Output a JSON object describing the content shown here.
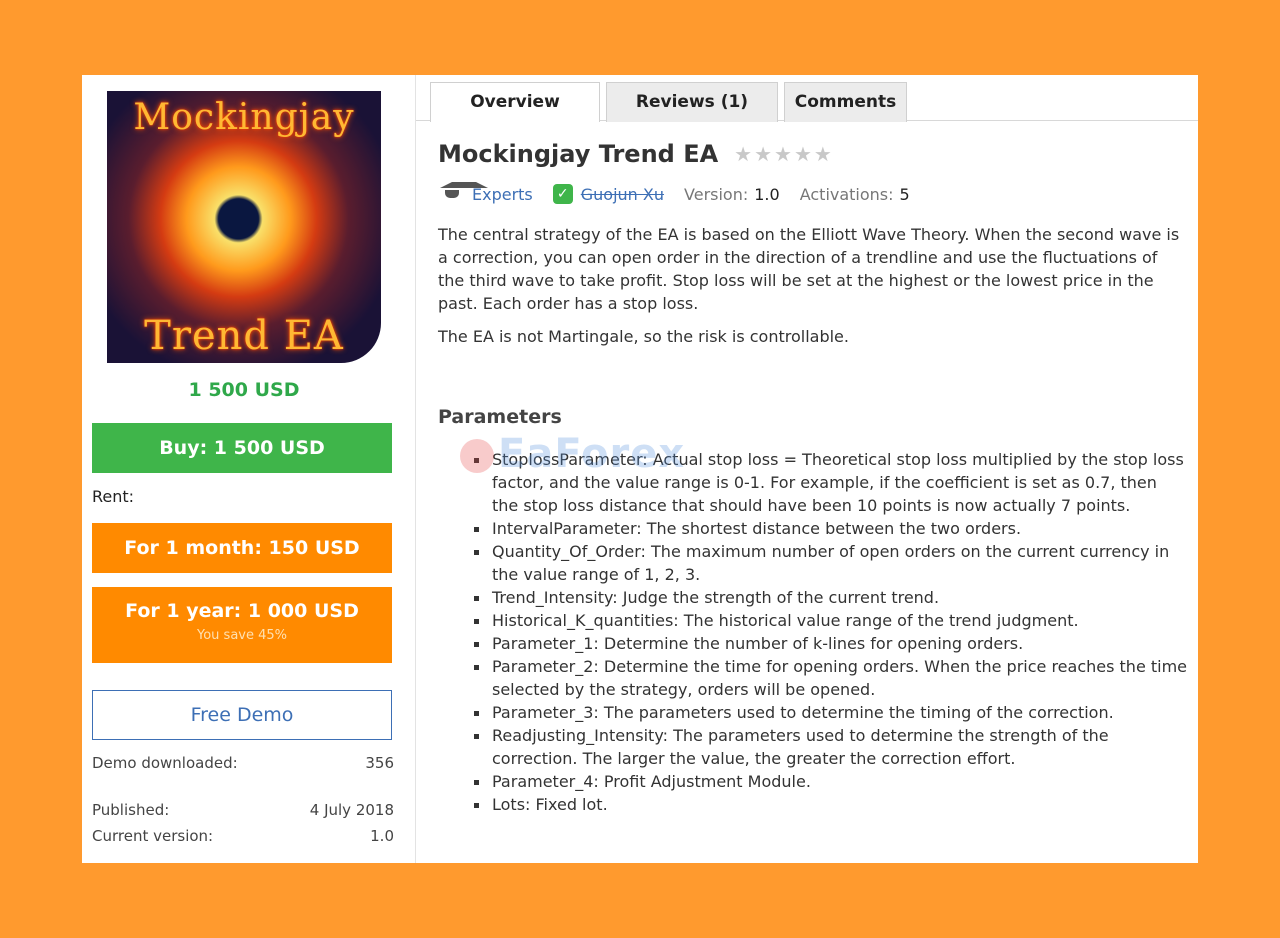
{
  "image": {
    "top_text": "Mockingjay",
    "bottom_text": "Trend EA"
  },
  "sidebar": {
    "price": "1 500 USD",
    "buy_label": "Buy: 1 500 USD",
    "rent_label": "Rent:",
    "month_label": "For 1 month: 150 USD",
    "year_label": "For 1 year: 1 000 USD",
    "year_save": "You save 45%",
    "demo_label": "Free Demo",
    "info": [
      {
        "label": "Demo downloaded:",
        "value": "356"
      },
      {
        "label": "Published:",
        "value": "4 July 2018"
      },
      {
        "label": "Current version:",
        "value": "1.0"
      }
    ]
  },
  "tabs": {
    "overview": "Overview",
    "reviews": "Reviews (1)",
    "comments": "Comments"
  },
  "product": {
    "title": "Mockingjay Trend EA",
    "stars": "★★★★★",
    "category": "Experts",
    "author": "Guojun Xu",
    "version_label": "Version:",
    "version": "1.0",
    "activations_label": "Activations:",
    "activations": "5"
  },
  "description": {
    "p1": "The central strategy of the EA is based on the Elliott Wave Theory. When the second wave is a correction, you can open order in the direction of a trendline and use the fluctuations of the third wave to take profit. Stop loss will be set at the highest or the lowest price in the past. Each order has a stop loss.",
    "p2": "The EA is not Martingale, so the risk is controllable."
  },
  "parameters": {
    "title": "Parameters",
    "items": [
      "StoplossParameter: Actual stop loss = Theoretical stop loss multiplied by the stop loss factor, and the value range is 0-1. For example, if the coefficient is set as 0.7, then the stop loss distance that should have been 10 points is now actually 7 points.",
      "IntervalParameter: The shortest distance between the two orders.",
      "Quantity_Of_Order: The maximum number of open orders on the current currency in the value range of 1, 2, 3.",
      "Trend_Intensity: Judge the strength of the current trend.",
      "Historical_K_quantities: The historical value range of the trend judgment.",
      "Parameter_1: Determine the number of k-lines for opening orders.",
      "Parameter_2: Determine the time for opening orders. When the price reaches the time selected by the strategy, orders will be opened.",
      "Parameter_3: The parameters used to determine the timing of the correction.",
      "Readjusting_Intensity: The parameters used to determine the strength of the correction. The larger the value, the greater the correction effort.",
      "Parameter_4: Profit Adjustment Module.",
      "Lots: Fixed lot."
    ]
  },
  "watermark": "EaForex",
  "colors": {
    "background": "#ff9a2e",
    "buy_green": "#3fb54a",
    "rent_orange": "#ff8a00",
    "link_blue": "#3d6fb5"
  }
}
